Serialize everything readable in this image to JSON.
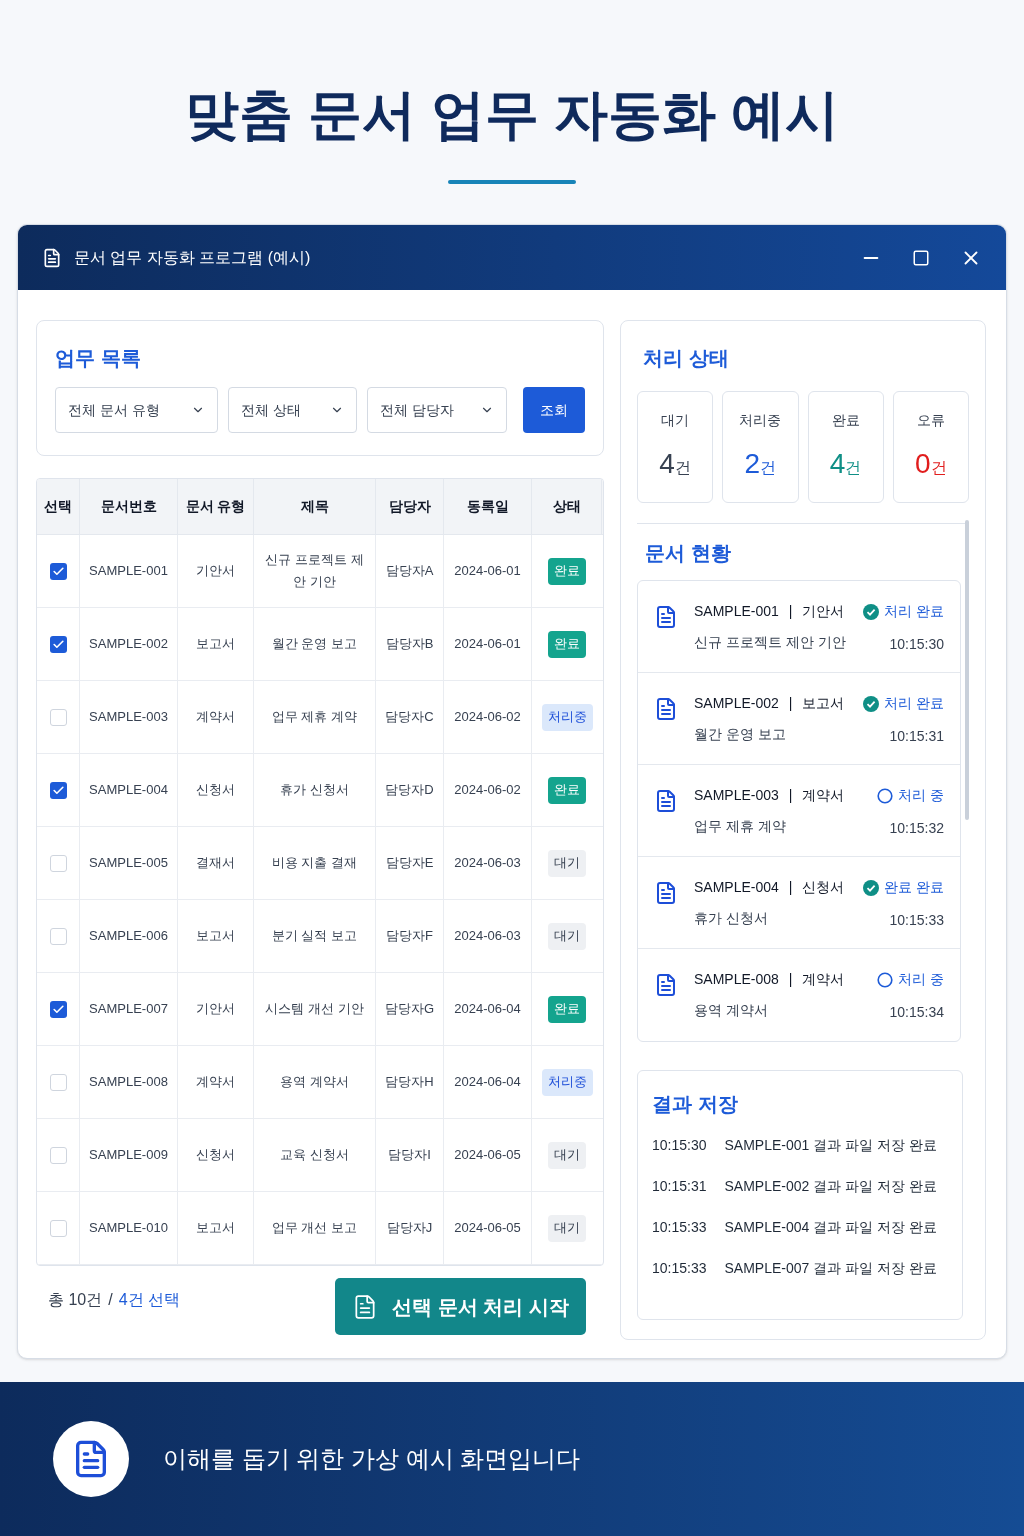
{
  "page_title": "맞춤 문서 업무 자동화 예시",
  "window": {
    "title": "문서 업무 자동화 프로그램 (예시)"
  },
  "task_list": {
    "title": "업무 목록",
    "filters": [
      "전체 문서 유형",
      "전체 상태",
      "전체 담당자"
    ],
    "search_button": "조회"
  },
  "table": {
    "columns": [
      "선택",
      "문서번호",
      "문서 유형",
      "제목",
      "담당자",
      "동록일",
      "상태"
    ],
    "rows": [
      {
        "checked": true,
        "number": "SAMPLE-001",
        "type": "기안서",
        "title": "신규 프로젝트 제안 기안",
        "owner": "담당자A",
        "date": "2024-06-01",
        "status": "완료",
        "kind": "done"
      },
      {
        "checked": true,
        "number": "SAMPLE-002",
        "type": "보고서",
        "title": "월간 운영 보고",
        "owner": "담당자B",
        "date": "2024-06-01",
        "status": "완료",
        "kind": "done"
      },
      {
        "checked": false,
        "number": "SAMPLE-003",
        "type": "계약서",
        "title": "업무 제휴 계약",
        "owner": "담당자C",
        "date": "2024-06-02",
        "status": "처리중",
        "kind": "processing"
      },
      {
        "checked": true,
        "number": "SAMPLE-004",
        "type": "신청서",
        "title": "휴가 신청서",
        "owner": "담당자D",
        "date": "2024-06-02",
        "status": "완료",
        "kind": "done"
      },
      {
        "checked": false,
        "number": "SAMPLE-005",
        "type": "결재서",
        "title": "비용 지출 결재",
        "owner": "담당자E",
        "date": "2024-06-03",
        "status": "대기",
        "kind": "waiting"
      },
      {
        "checked": false,
        "number": "SAMPLE-006",
        "type": "보고서",
        "title": "분기 실적 보고",
        "owner": "담당자F",
        "date": "2024-06-03",
        "status": "대기",
        "kind": "waiting"
      },
      {
        "checked": true,
        "number": "SAMPLE-007",
        "type": "기안서",
        "title": "시스템 개선 기안",
        "owner": "담당자G",
        "date": "2024-06-04",
        "status": "완료",
        "kind": "done"
      },
      {
        "checked": false,
        "number": "SAMPLE-008",
        "type": "계약서",
        "title": "용역 계약서",
        "owner": "담당자H",
        "date": "2024-06-04",
        "status": "처리중",
        "kind": "processing"
      },
      {
        "checked": false,
        "number": "SAMPLE-009",
        "type": "신청서",
        "title": "교육 신청서",
        "owner": "담당자I",
        "date": "2024-06-05",
        "status": "대기",
        "kind": "waiting"
      },
      {
        "checked": false,
        "number": "SAMPLE-010",
        "type": "보고서",
        "title": "업무 개선 보고",
        "owner": "담당자J",
        "date": "2024-06-05",
        "status": "대기",
        "kind": "waiting"
      }
    ]
  },
  "summary": {
    "total": "총 10건",
    "separator": "/",
    "selected": "4건 선택"
  },
  "start_button": "선택 문서 처리 시작",
  "process_status": {
    "title": "처리 상태",
    "cards": [
      {
        "label": "대기",
        "count": "4",
        "unit": "건",
        "kind": "waiting"
      },
      {
        "label": "처리중",
        "count": "2",
        "unit": "건",
        "kind": "processing"
      },
      {
        "label": "완료",
        "count": "4",
        "unit": "건",
        "kind": "done"
      },
      {
        "label": "오류",
        "count": "0",
        "unit": "건",
        "kind": "error"
      }
    ]
  },
  "documents": {
    "title": "문서 현황",
    "separator": "|",
    "items": [
      {
        "number": "SAMPLE-001",
        "type": "기안서",
        "title": "신규 프로젝트 제안 기안",
        "status": "처리 완료",
        "kind": "done",
        "time": "10:15:30"
      },
      {
        "number": "SAMPLE-002",
        "type": "보고서",
        "title": "월간 운영 보고",
        "status": "처리 완료",
        "kind": "done",
        "time": "10:15:31"
      },
      {
        "number": "SAMPLE-003",
        "type": "계약서",
        "title": "업무 제휴 계약",
        "status": "처리 중",
        "kind": "processing",
        "time": "10:15:32"
      },
      {
        "number": "SAMPLE-004",
        "type": "신청서",
        "title": "휴가 신청서",
        "status": "완료 완료",
        "kind": "done",
        "time": "10:15:33"
      },
      {
        "number": "SAMPLE-008",
        "type": "계약서",
        "title": "용역 계약서",
        "status": "처리 중",
        "kind": "processing",
        "time": "10:15:34"
      }
    ]
  },
  "results": {
    "title": "결과 저장",
    "entries": [
      {
        "time": "10:15:30",
        "message": "SAMPLE-001 결과 파일 저장 완료"
      },
      {
        "time": "10:15:31",
        "message": "SAMPLE-002 결과 파일 저장 완료"
      },
      {
        "time": "10:15:33",
        "message": "SAMPLE-004 결과 파일 저장 완료"
      },
      {
        "time": "10:15:33",
        "message": "SAMPLE-007 결과 파일 저장 완료"
      }
    ]
  },
  "footer": {
    "text": "이해를 돕기 위한 가상 예시 화면입니다"
  }
}
